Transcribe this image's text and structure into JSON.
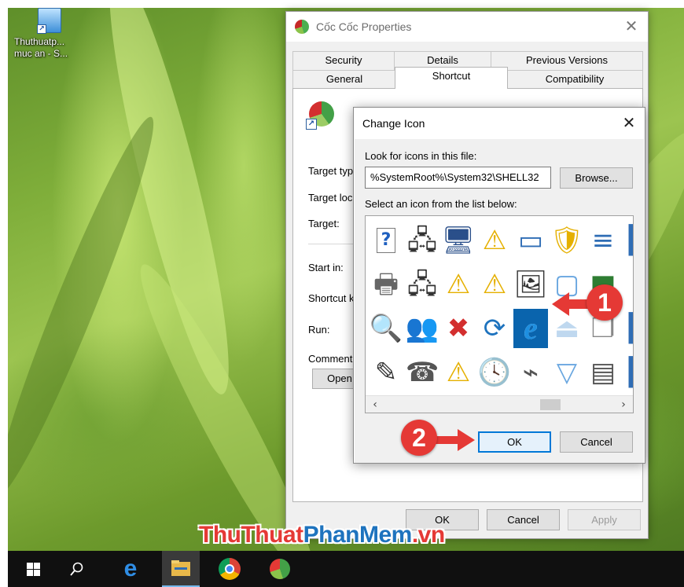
{
  "desktop": {
    "icon_label_line1": "Thuthuatp...",
    "icon_label_line2": "muc an - S..."
  },
  "properties": {
    "title": "Cốc Cốc Properties",
    "tabs": [
      {
        "label": "Security"
      },
      {
        "label": "Details"
      },
      {
        "label": "Previous Versions"
      },
      {
        "label": "General"
      },
      {
        "label": "Shortcut"
      },
      {
        "label": "Compatibility"
      }
    ],
    "fields": {
      "target_type": "Target typ",
      "target_location": "Target loc",
      "target": "Target:",
      "start_in": "Start in:",
      "shortcut_key": "Shortcut k",
      "run": "Run:",
      "comment": "Comment:"
    },
    "open_label": "Open",
    "ok_label": "OK",
    "cancel_label": "Cancel",
    "apply_label": "Apply"
  },
  "change_icon": {
    "title": "Change Icon",
    "look_label": "Look for icons in this file:",
    "path_value": "%SystemRoot%\\System32\\SHELL32",
    "browse_label": "Browse...",
    "select_label": "Select an icon from the list below:",
    "ok_label": "OK",
    "cancel_label": "Cancel",
    "icons": [
      [
        "help-icon",
        "network-pc-icon",
        "computer-icon",
        "warning-icon",
        "monitor-icon",
        "shield-warning-icon",
        "filter-icon",
        "partial-icon"
      ],
      [
        "printer-icon",
        "network-pc-icon",
        "warning-icon",
        "warning-icon",
        "photo-icon",
        "frame-icon",
        "chart-icon",
        "document-icon"
      ],
      [
        "network-search-icon",
        "users-icon",
        "folder-error-icon",
        "refresh-icon",
        "internet-explorer-icon",
        "eject-icon",
        "stack-icon",
        "partial-icon"
      ],
      [
        "network-edit-icon",
        "fax-icon",
        "warning-icon",
        "clock-icon",
        "usb-icon",
        "dropdown-icon",
        "window-icon",
        "partial-icon"
      ]
    ],
    "selected_icon": "internet-explorer-icon"
  },
  "annotations": {
    "step1": "1",
    "step2": "2"
  },
  "watermark": {
    "part1": "ThuThuat",
    "part2": "PhanMem",
    "part3": ".vn"
  }
}
